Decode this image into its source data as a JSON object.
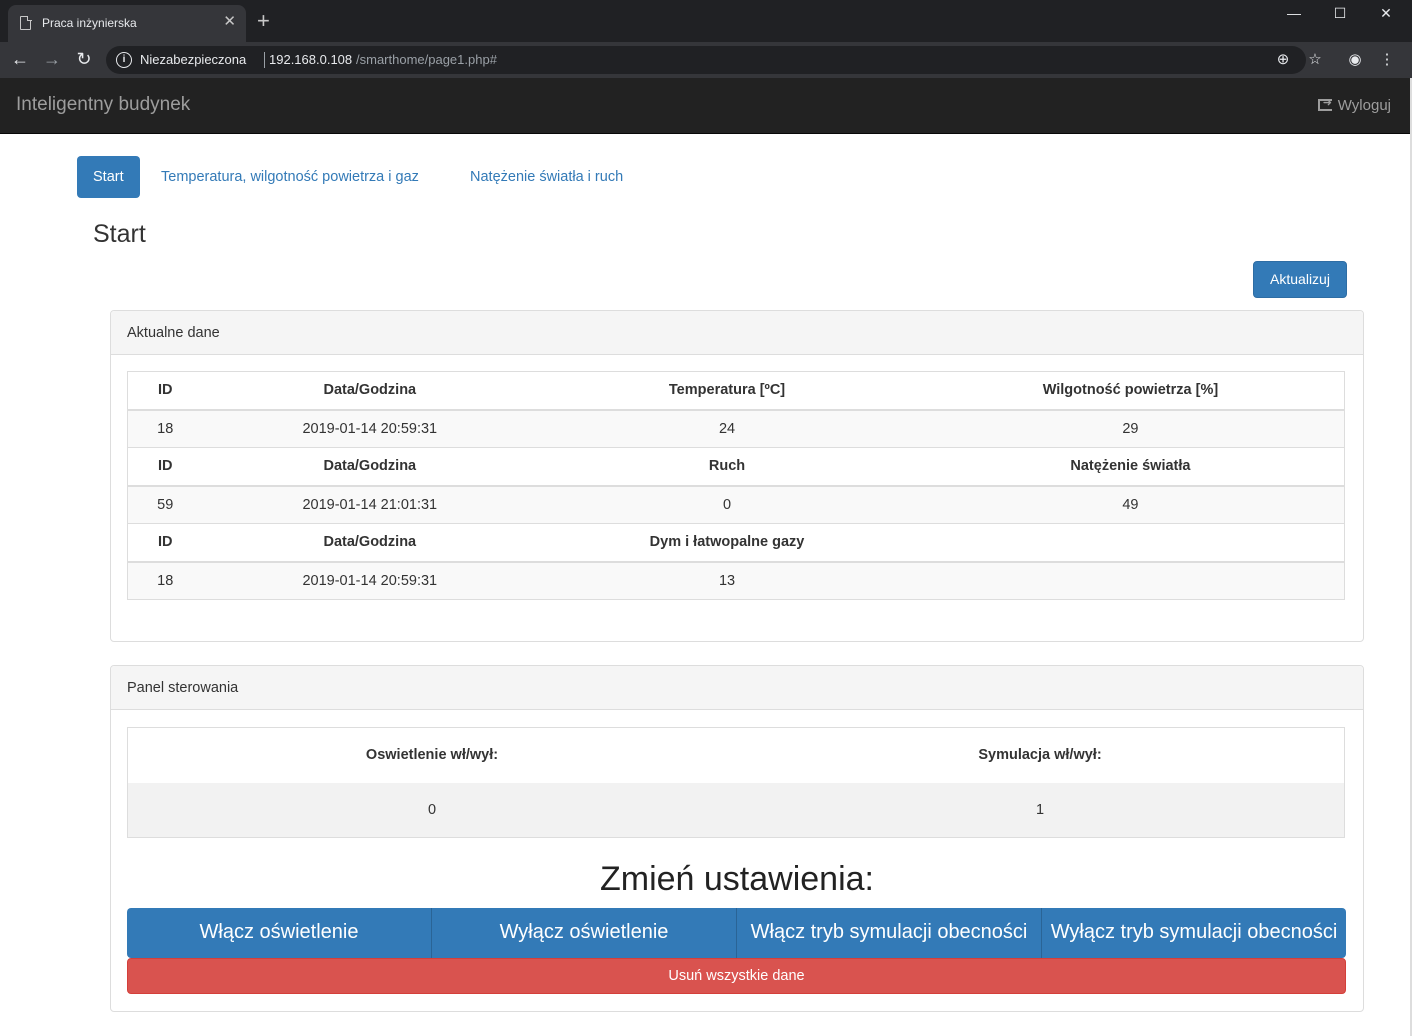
{
  "browser": {
    "tab_title": "Praca inżynierska",
    "security_label": "Niezabezpieczona",
    "url_host": "192.168.0.108",
    "url_path": "/smarthome/page1.php#"
  },
  "navbar": {
    "brand": "Inteligentny budynek",
    "logout": "Wyloguj"
  },
  "tabs": [
    {
      "label": "Start",
      "active": true
    },
    {
      "label": "Temperatura, wilgotność powietrza i gaz",
      "active": false
    },
    {
      "label": "Natężenie światła i ruch",
      "active": false
    }
  ],
  "page_title": "Start",
  "update_button": "Aktualizuj",
  "current_data": {
    "heading": "Aktualne dane",
    "sections": [
      {
        "headers": [
          "ID",
          "Data/Godzina",
          "Temperatura [ºC]",
          "Wilgotność powietrza [%]"
        ],
        "values": [
          "18",
          "2019-01-14 20:59:31",
          "24",
          "29"
        ]
      },
      {
        "headers": [
          "ID",
          "Data/Godzina",
          "Ruch",
          "Natężenie światła"
        ],
        "values": [
          "59",
          "2019-01-14 21:01:31",
          "0",
          "49"
        ]
      },
      {
        "headers": [
          "ID",
          "Data/Godzina",
          "Dym i łatwopalne gazy",
          ""
        ],
        "values": [
          "18",
          "2019-01-14 20:59:31",
          "13",
          ""
        ]
      }
    ]
  },
  "control_panel": {
    "heading": "Panel sterowania",
    "headers": [
      "Oswietlenie wł/wył:",
      "Symulacja wł/wył:"
    ],
    "values": [
      "0",
      "1"
    ],
    "change_title": "Zmień ustawienia:",
    "buttons": [
      "Włącz oświetlenie",
      "Wyłącz oświetlenie",
      "Włącz tryb symulacji obecności",
      "Wyłącz tryb symulacji obecności"
    ],
    "delete_button": "Usuń wszystkie dane"
  },
  "colors": {
    "primary": "#337ab7",
    "danger": "#d9534f",
    "navbar": "#222222"
  }
}
